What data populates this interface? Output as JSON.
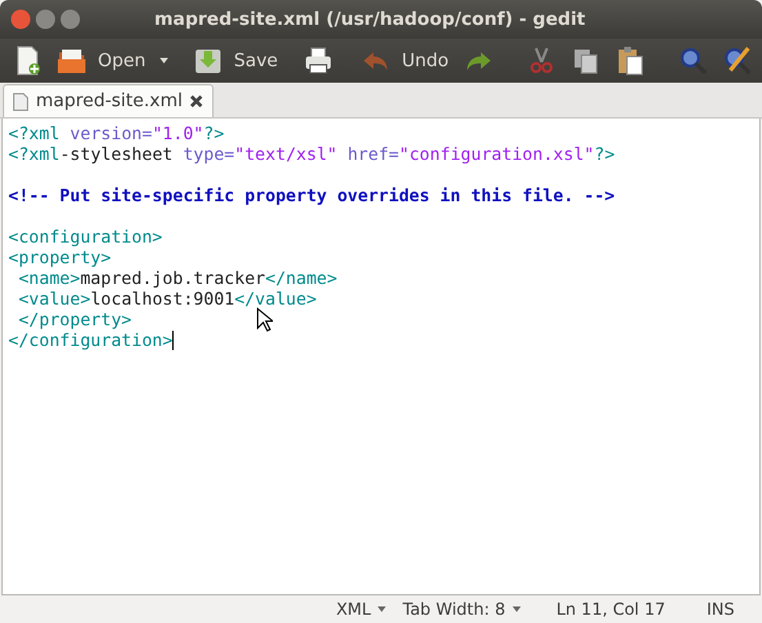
{
  "window": {
    "title": "mapred-site.xml (/usr/hadoop/conf) - gedit"
  },
  "toolbar": [
    {
      "kind": "new"
    },
    {
      "kind": "open",
      "label": "Open"
    },
    {
      "kind": "menu"
    },
    {
      "kind": "save",
      "label": "Save"
    },
    {
      "kind": "print"
    },
    {
      "kind": "undo",
      "label": "Undo"
    },
    {
      "kind": "redo"
    },
    {
      "kind": "cut"
    },
    {
      "kind": "copy"
    },
    {
      "kind": "paste"
    },
    {
      "kind": "search"
    },
    {
      "kind": "replace"
    }
  ],
  "tabs": [
    {
      "label": "mapred-site.xml",
      "selected": true
    }
  ],
  "editor": {
    "lines": [
      {
        "blank_line_before": false,
        "segments": [
          {
            "kind": "tag",
            "text": "<?xml"
          },
          {
            "kind": "attr",
            "text": " version="
          },
          {
            "kind": "string",
            "text": "\"1.0\""
          },
          {
            "kind": "tag",
            "text": "?>"
          }
        ]
      },
      {
        "blank_line_before": false,
        "segments": [
          {
            "kind": "tag",
            "text": "<?xml"
          },
          {
            "kind": "text",
            "text": "-stylesheet"
          },
          {
            "kind": "attr",
            "text": " type="
          },
          {
            "kind": "string",
            "text": "\"text/xsl\""
          },
          {
            "kind": "attr",
            "text": " href="
          },
          {
            "kind": "string",
            "text": "\"configuration.xsl\""
          },
          {
            "kind": "tag",
            "text": "?>"
          }
        ]
      },
      {
        "blank_line_before": true,
        "segments": [
          {
            "kind": "comment",
            "text": "<!-- Put site-specific property overrides in this file. -->"
          }
        ]
      },
      {
        "blank_line_before": true,
        "segments": [
          {
            "kind": "tag",
            "text": "<configuration>"
          }
        ]
      },
      {
        "blank_line_before": false,
        "segments": [
          {
            "kind": "tag",
            "text": "<property>"
          }
        ]
      },
      {
        "blank_line_before": false,
        "segments": [
          {
            "kind": "tag",
            "text": " <name>"
          },
          {
            "kind": "text",
            "text": "mapred.job.tracker"
          },
          {
            "kind": "tag",
            "text": "</name>"
          }
        ]
      },
      {
        "blank_line_before": false,
        "segments": [
          {
            "kind": "tag",
            "text": " <value>"
          },
          {
            "kind": "text",
            "text": "localhost:9001"
          },
          {
            "kind": "tag",
            "text": "</value>"
          }
        ]
      },
      {
        "blank_line_before": false,
        "segments": [
          {
            "kind": "tag",
            "text": " </property>"
          }
        ]
      },
      {
        "blank_line_before": false,
        "segments": [
          {
            "kind": "tag",
            "text": "</configuration>"
          }
        ]
      }
    ]
  },
  "status_bar": {
    "language": "XML",
    "tab_width": "Tab Width: 8",
    "position": "Ln 11, Col 17",
    "mode": "INS"
  }
}
